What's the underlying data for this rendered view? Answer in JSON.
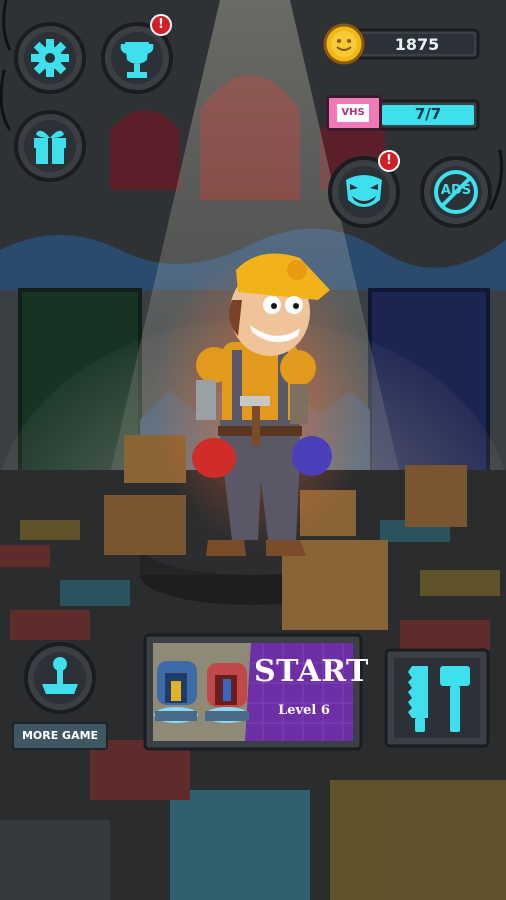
{
  "hud": {
    "coins": "1875",
    "vhs_label": "VHS",
    "tapes": "7/7",
    "ads_label": "ADS",
    "trophy_alert": "!",
    "monster_alert": "!"
  },
  "bottom": {
    "more_game_label": "MORE GAME",
    "start_label": "START",
    "level_label": "Level 6"
  },
  "colors": {
    "accent_cyan": "#3de0ec",
    "panel_dark": "#2b3136",
    "start_purple": "#6d2ea6",
    "coin_gold": "#f2b81a",
    "vhs_pink": "#ee7bb5",
    "alert_red": "#d21f26"
  },
  "icons": {
    "settings": "gear-icon",
    "trophy": "trophy-icon",
    "gift": "gift-icon",
    "monster": "monster-face-icon",
    "no_ads": "no-ads-icon",
    "more_game": "joystick-icon",
    "tools": "saw-hammer-icon"
  }
}
